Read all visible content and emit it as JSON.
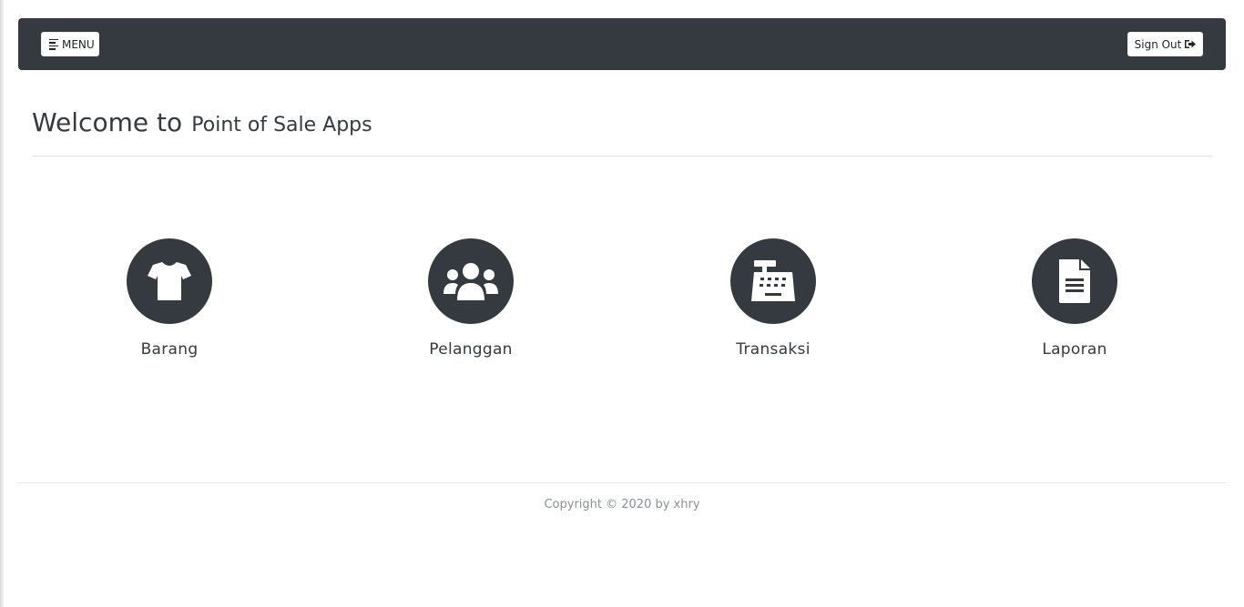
{
  "navbar": {
    "menu_label": "MENU",
    "menu_icon": "bars-icon",
    "signout_label": "Sign Out",
    "signout_icon": "sign-out-icon"
  },
  "header": {
    "title_main": "Welcome to",
    "title_sub": "Point of Sale Apps"
  },
  "modules": [
    {
      "label": "Barang",
      "icon": "tshirt-icon"
    },
    {
      "label": "Pelanggan",
      "icon": "users-icon"
    },
    {
      "label": "Transaksi",
      "icon": "cash-register-icon"
    },
    {
      "label": "Laporan",
      "icon": "file-alt-icon"
    }
  ],
  "footer": {
    "copyright": "Copyright © 2020 by xhry"
  },
  "colors": {
    "dark": "#343a40",
    "background": "#ffffff",
    "muted": "#8a8f94"
  }
}
